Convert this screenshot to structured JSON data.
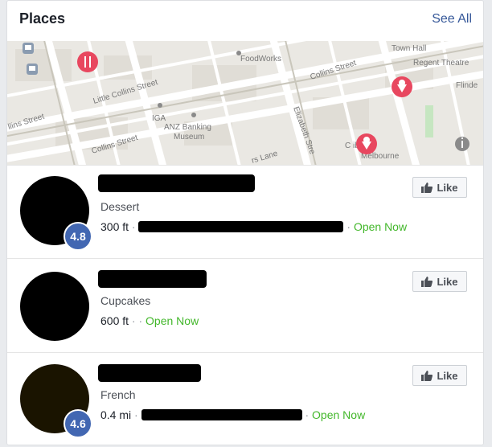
{
  "header": {
    "title": "Places",
    "see_all": "See All"
  },
  "map": {
    "labels": {
      "town_hall": "Town Hall",
      "regent_theatre": "Regent Theatre",
      "foodworks": "FoodWorks",
      "collins_street_right": "Collins Street",
      "little_collins": "Little Collins Street",
      "flinders": "Flinde",
      "collins_street_left": "llins Street",
      "collins_street_bottom": "Collins Street",
      "iga": "IGA",
      "anz_banking": "ANZ Banking",
      "museum": "Museum",
      "elizabeth": "Elizabeth Stre",
      "lane": "rs Lane",
      "library": "C    ibrary",
      "melbourne": "Melbourne"
    }
  },
  "places": [
    {
      "category": "Dessert",
      "distance": "300 ft",
      "sep": "·",
      "open": "Open Now",
      "rating": "4.8",
      "like": "Like"
    },
    {
      "category": "Cupcakes",
      "distance": "600 ft",
      "sep": "· ·",
      "open": "Open Now",
      "rating": "",
      "like": "Like"
    },
    {
      "category": "French",
      "distance": "0.4 mi",
      "sep": "·",
      "open": "Open Now",
      "rating": "4.6",
      "like": "Like"
    }
  ]
}
